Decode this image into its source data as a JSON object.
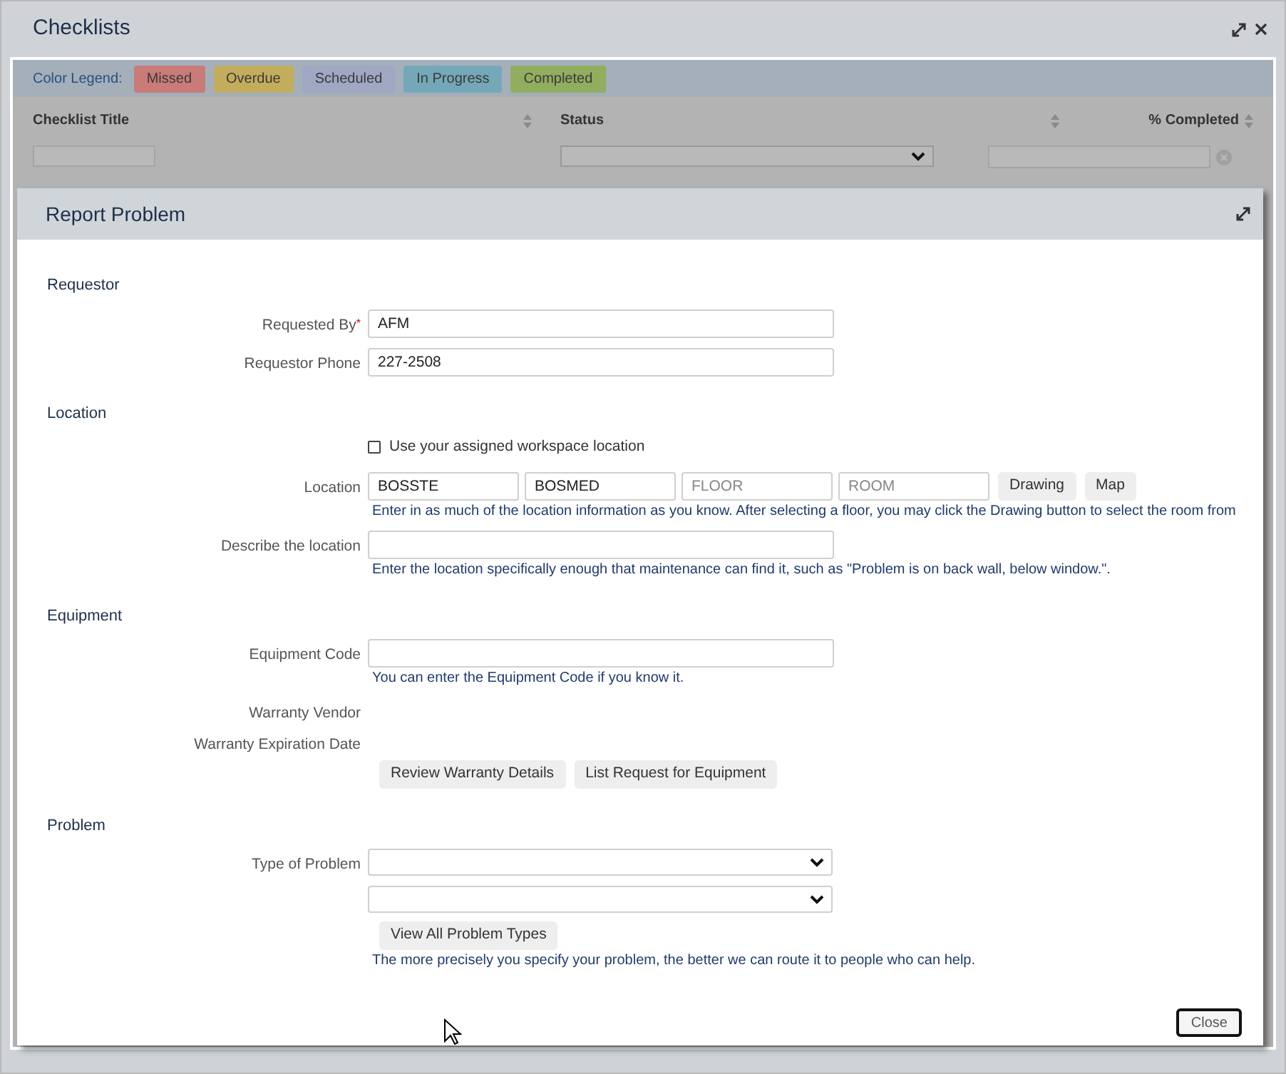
{
  "window": {
    "title": "Checklists"
  },
  "legend": {
    "label": "Color Legend:",
    "items": [
      {
        "label": "Missed",
        "color": "#c97b78"
      },
      {
        "label": "Overdue",
        "color": "#c3ad5c"
      },
      {
        "label": "Scheduled",
        "color": "#9fa7c3"
      },
      {
        "label": "In Progress",
        "color": "#74a8b8"
      },
      {
        "label": "Completed",
        "color": "#91ad5e"
      }
    ]
  },
  "table": {
    "columns": [
      {
        "label": "Checklist Title",
        "kind": "text"
      },
      {
        "label": "Status",
        "kind": "select"
      },
      {
        "label": "% Completed",
        "kind": "clearable"
      }
    ]
  },
  "modal": {
    "title": "Report Problem",
    "sections": [
      {
        "heading": "Requestor",
        "rows": [
          {
            "kind": "text",
            "label": "Requested By",
            "required_mark": "*",
            "value": "AFM"
          },
          {
            "kind": "text",
            "label": "Requestor Phone",
            "value": "227-2508"
          }
        ]
      },
      {
        "heading": "Location",
        "rows": [
          {
            "kind": "checkbox",
            "text": "Use your assigned workspace location",
            "checked": false
          },
          {
            "kind": "location",
            "label": "Location",
            "fields": [
              {
                "value": "BOSSTE"
              },
              {
                "value": "BOSMED"
              },
              {
                "placeholder": "FLOOR"
              },
              {
                "placeholder": "ROOM"
              }
            ],
            "buttons": [
              "Drawing",
              "Map"
            ],
            "hint": "Enter in as much of the location information as you know. After selecting a floor, you may click the Drawing button to select the room from"
          },
          {
            "kind": "text",
            "label": "Describe the location",
            "hint": "Enter the location specifically enough that maintenance can find it, such as \"Problem is on back wall, below window.\"."
          }
        ]
      },
      {
        "heading": "Equipment",
        "rows": [
          {
            "kind": "text",
            "label": "Equipment Code",
            "hint": "You can enter the Equipment Code if you know it."
          },
          {
            "kind": "static",
            "label": "Warranty Vendor"
          },
          {
            "kind": "static",
            "label": "Warranty Expiration Date"
          },
          {
            "kind": "buttons",
            "buttons": [
              "Review Warranty Details",
              "List Request for Equipment"
            ]
          }
        ]
      },
      {
        "heading": "Problem",
        "rows": [
          {
            "kind": "select",
            "label": "Type of Problem"
          },
          {
            "kind": "select"
          },
          {
            "kind": "buttons",
            "buttons": [
              "View All Problem Types"
            ],
            "hint": "The more precisely you specify your problem, the better we can route it to people who can help."
          }
        ]
      }
    ],
    "close_button": "Close"
  }
}
